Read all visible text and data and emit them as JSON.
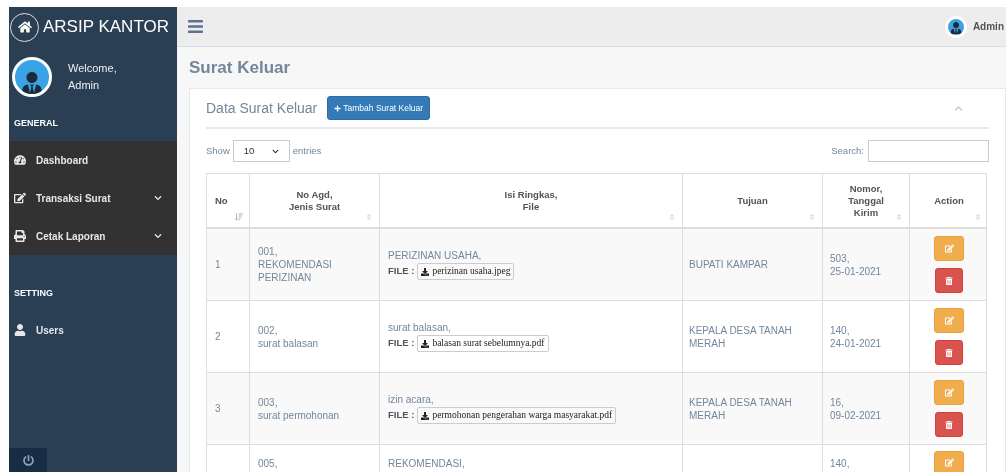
{
  "brand": "ARSIP KANTOR",
  "profile": {
    "greeting": "Welcome,",
    "name": "Admin"
  },
  "sidebar": {
    "sections": [
      {
        "title": "GENERAL",
        "items": [
          {
            "label": "Dashboard",
            "expandable": false
          },
          {
            "label": "Transaksi Surat",
            "expandable": true
          },
          {
            "label": "Cetak Laporan",
            "expandable": true
          }
        ]
      },
      {
        "title": "SETTING",
        "items": [
          {
            "label": "Users",
            "expandable": false
          }
        ]
      }
    ]
  },
  "topbar": {
    "user": "Admin"
  },
  "page_title": "Surat Keluar",
  "panel": {
    "title": "Data Surat Keluar",
    "add_button": "Tambah Surat Keluar"
  },
  "table_controls": {
    "show_label": "Show",
    "page_size": "10",
    "entries_label": "entries",
    "search_label": "Search:"
  },
  "table": {
    "columns": [
      "No",
      "No Agd,\nJenis Surat",
      "Isi Ringkas,\nFile",
      "Tujuan",
      "Nomor,\nTanggal\nKirim",
      "Action"
    ],
    "rows": [
      {
        "no": "1",
        "agd": "001,\nREKOMENDASI PERIZINAN",
        "isi": "PERIZINAN USAHA,",
        "file_label": "FILE :",
        "file": "perizinan usaha.jpeg",
        "tujuan": "BUPATI KAMPAR",
        "nomor": "503,\n25-01-2021"
      },
      {
        "no": "2",
        "agd": "002,\nsurat balasan",
        "isi": "surat balasan,",
        "file_label": "FILE :",
        "file": "balasan surat sebelumnya.pdf",
        "tujuan": "KEPALA DESA TANAH MERAH",
        "nomor": "140,\n24-01-2021"
      },
      {
        "no": "3",
        "agd": "003,\nsurat permohonan",
        "isi": "izin acara,",
        "file_label": "FILE :",
        "file": "permohonan pengerahan warga masyarakat.pdf",
        "tujuan": "KEPALA DESA TANAH MERAH",
        "nomor": "16,\n09-02-2021"
      },
      {
        "agd": "005,",
        "isi": "REKOMENDASI,",
        "nomor": "140,"
      }
    ]
  }
}
